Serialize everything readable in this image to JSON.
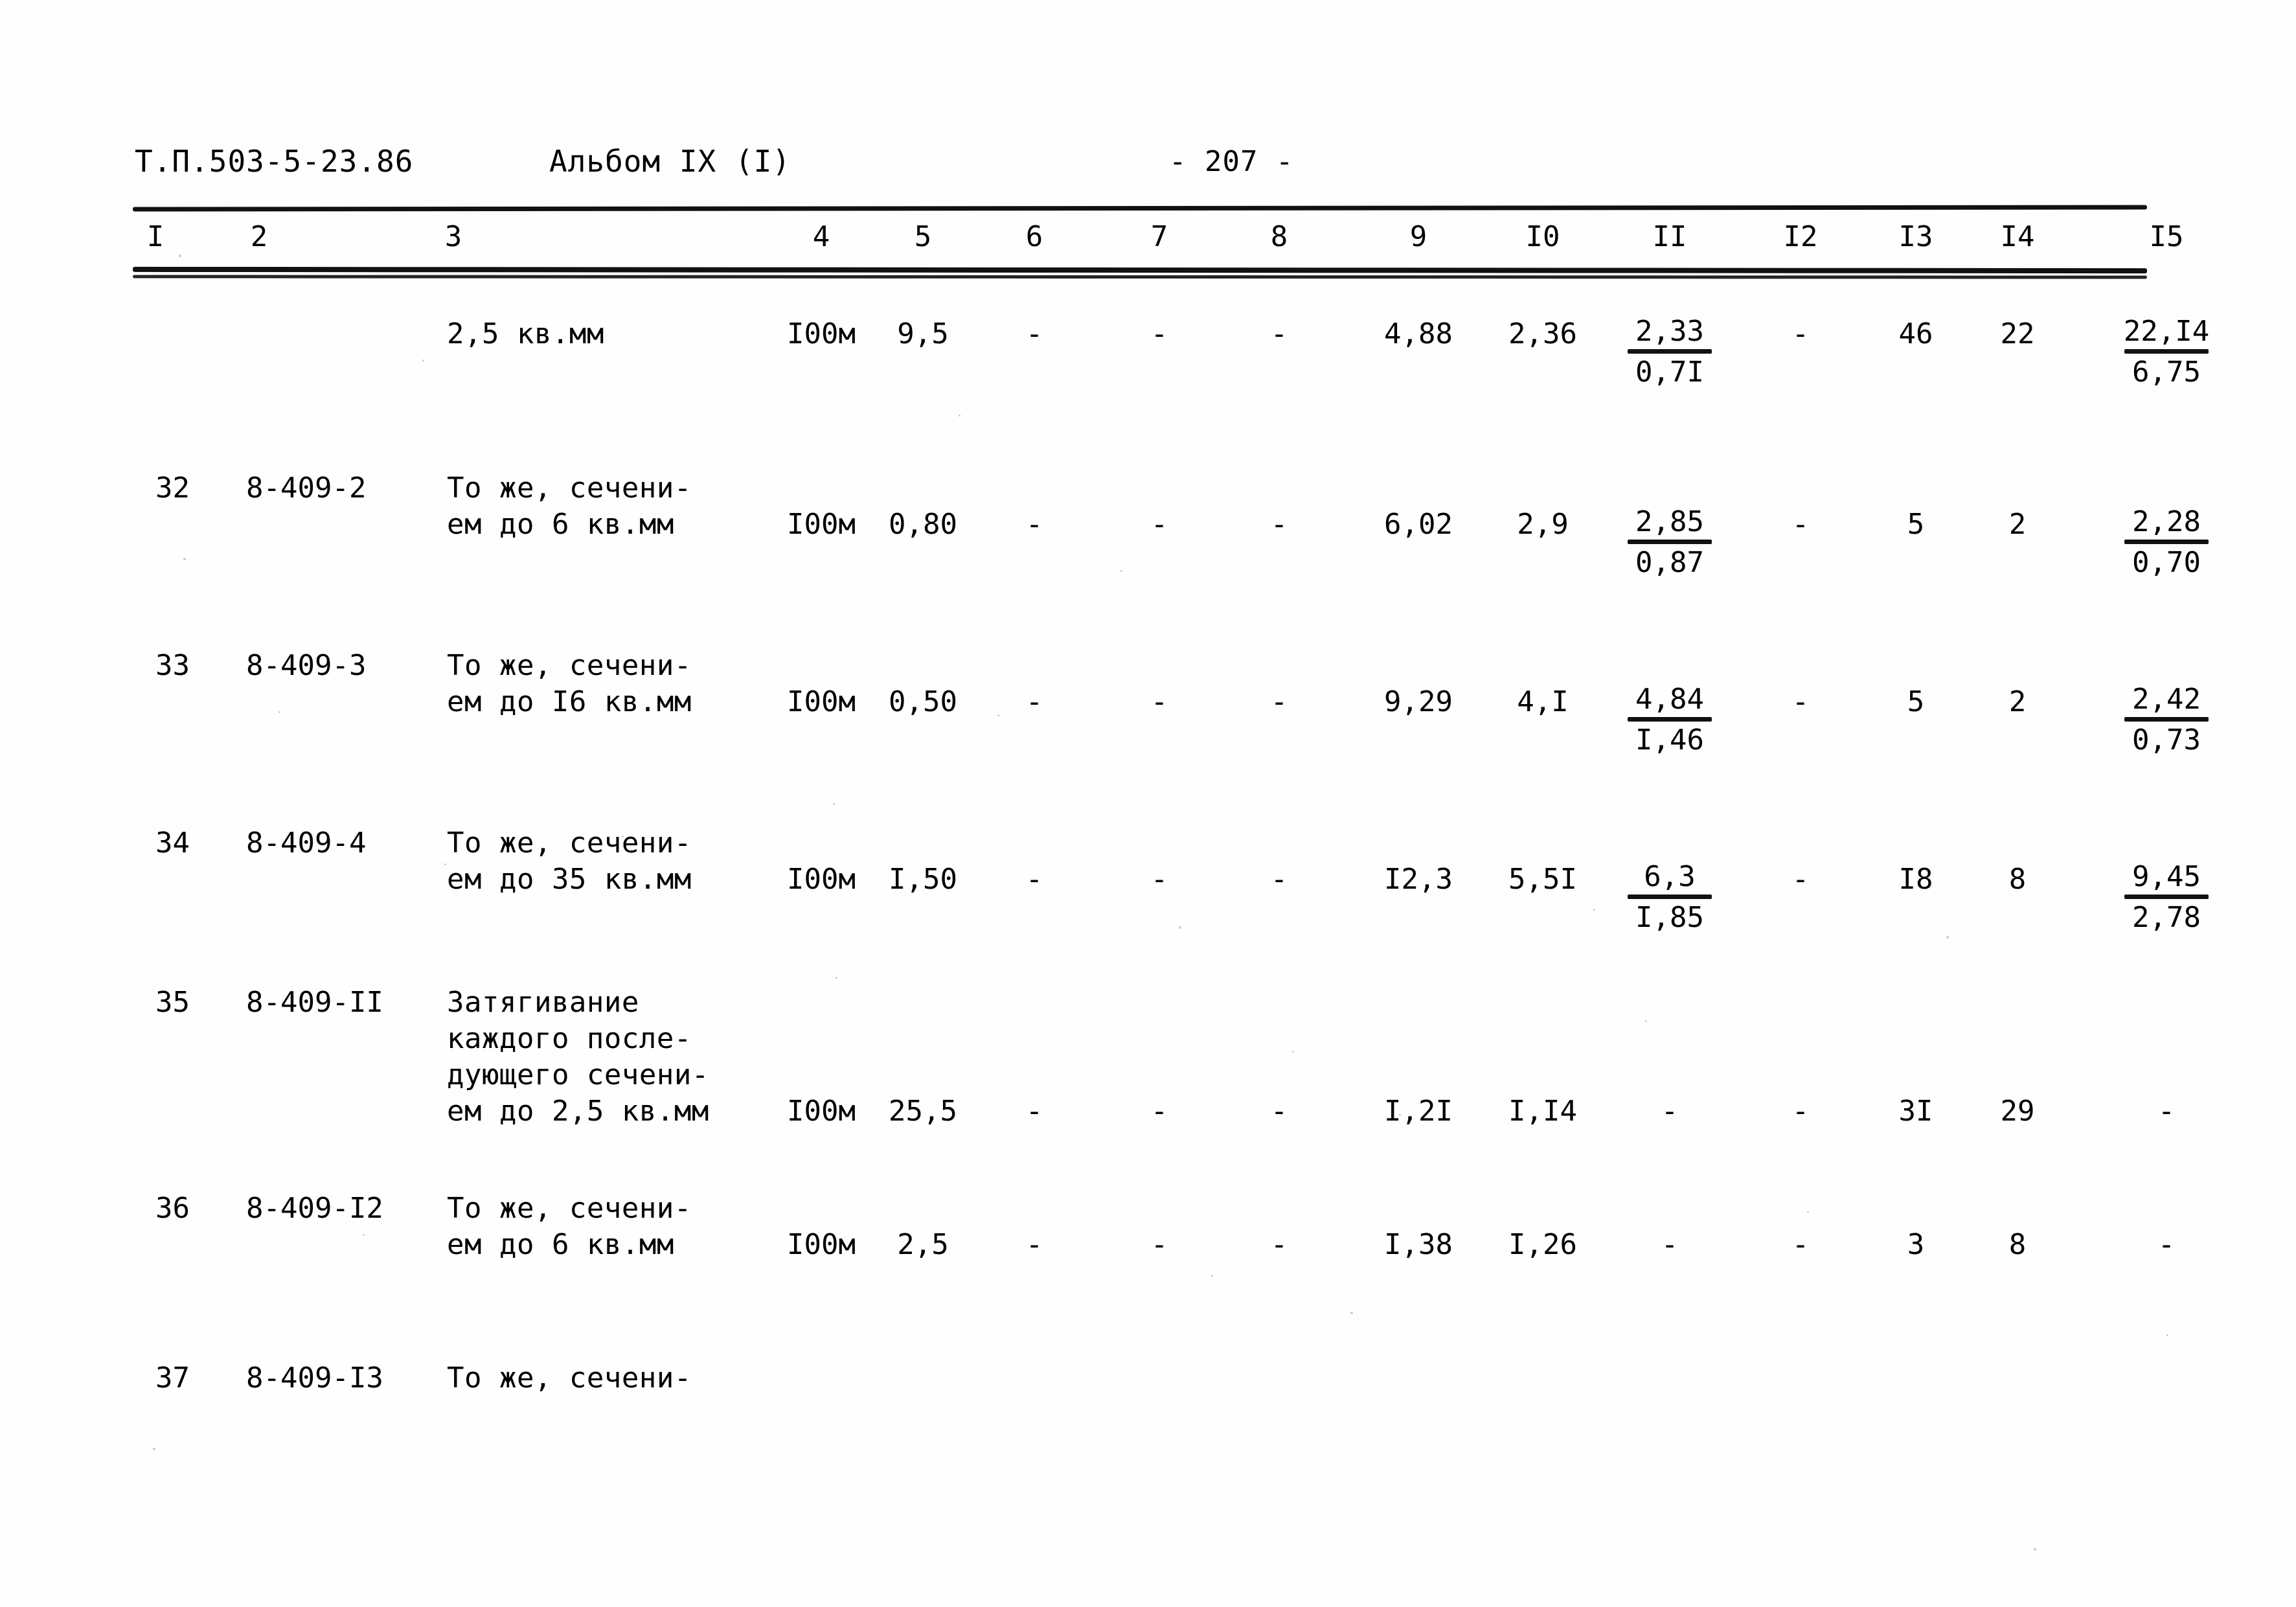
{
  "document": {
    "code": "Т.П.503-5-23.86",
    "album": "Альбом IX (I)",
    "page_marker": "- 207 -"
  },
  "table": {
    "column_numbers": [
      "I",
      "2",
      "3",
      "4",
      "5",
      "6",
      "7",
      "8",
      "9",
      "I0",
      "II",
      "I2",
      "I3",
      "I4",
      "I5"
    ],
    "rows": [
      {
        "c1": "",
        "c2": "",
        "c3": [
          "2,5 кв.мм"
        ],
        "c4": "I00м",
        "c5": "9,5",
        "c6": "-",
        "c7": "-",
        "c8": "-",
        "c9": "4,88",
        "c10": "2,36",
        "c11_num": "2,33",
        "c11_den": "0,7I",
        "c12": "-",
        "c13": "46",
        "c14": "22",
        "c15_num": "22,I4",
        "c15_den": "6,75"
      },
      {
        "c1": "32",
        "c2": "8-409-2",
        "c3": [
          "То же, сечени-",
          "ем до 6 кв.мм"
        ],
        "c4": "I00м",
        "c5": "0,80",
        "c6": "-",
        "c7": "-",
        "c8": "-",
        "c9": "6,02",
        "c10": "2,9",
        "c11_num": "2,85",
        "c11_den": "0,87",
        "c12": "-",
        "c13": "5",
        "c14": "2",
        "c15_num": "2,28",
        "c15_den": "0,70"
      },
      {
        "c1": "33",
        "c2": "8-409-3",
        "c3": [
          "То же, сечени-",
          "ем до I6 кв.мм"
        ],
        "c4": "I00м",
        "c5": "0,50",
        "c6": "-",
        "c7": "-",
        "c8": "-",
        "c9": "9,29",
        "c10": "4,I",
        "c11_num": "4,84",
        "c11_den": "I,46",
        "c12": "-",
        "c13": "5",
        "c14": "2",
        "c15_num": "2,42",
        "c15_den": "0,73"
      },
      {
        "c1": "34",
        "c2": "8-409-4",
        "c3": [
          "То же, сечени-",
          "ем до 35 кв.мм"
        ],
        "c4": "I00м",
        "c5": "I,50",
        "c6": "-",
        "c7": "-",
        "c8": "-",
        "c9": "I2,3",
        "c10": "5,5I",
        "c11_num": "6,3",
        "c11_den": "I,85",
        "c12": "-",
        "c13": "I8",
        "c14": "8",
        "c15_num": "9,45",
        "c15_den": "2,78"
      },
      {
        "c1": "35",
        "c2": "8-409-II",
        "c3": [
          "Затягивание",
          "каждого после-",
          "дующего сечени-",
          "ем до 2,5 кв.мм"
        ],
        "c4": "I00м",
        "c5": "25,5",
        "c6": "-",
        "c7": "-",
        "c8": "-",
        "c9": "I,2I",
        "c10": "I,I4",
        "c11_num": "-",
        "c11_den": "",
        "c12": "-",
        "c13": "3I",
        "c14": "29",
        "c15_num": "-",
        "c15_den": ""
      },
      {
        "c1": "36",
        "c2": "8-409-I2",
        "c3": [
          "То же, сечени-",
          "ем до 6 кв.мм"
        ],
        "c4": "I00м",
        "c5": "2,5",
        "c6": "-",
        "c7": "-",
        "c8": "-",
        "c9": "I,38",
        "c10": "I,26",
        "c11_num": "-",
        "c11_den": "",
        "c12": "-",
        "c13": "3",
        "c14": "8",
        "c15_num": "-",
        "c15_den": ""
      },
      {
        "c1": "37",
        "c2": "8-409-I3",
        "c3": [
          "То же, сечени-"
        ],
        "c4": "",
        "c5": "",
        "c6": "",
        "c7": "",
        "c8": "",
        "c9": "",
        "c10": "",
        "c11_num": "",
        "c11_den": "",
        "c12": "",
        "c13": "",
        "c14": "",
        "c15_num": "",
        "c15_den": ""
      }
    ]
  }
}
